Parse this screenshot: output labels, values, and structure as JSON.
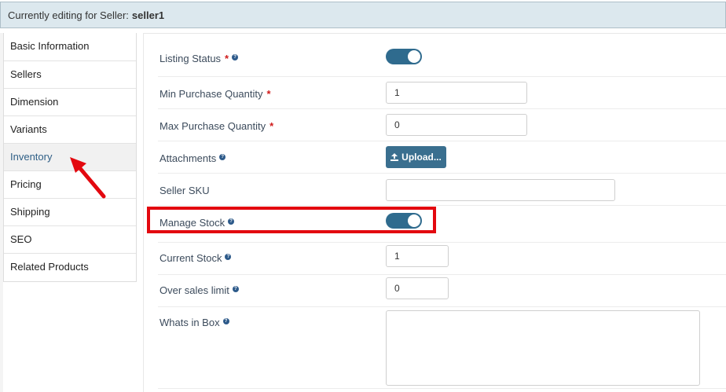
{
  "header": {
    "prefix": "Currently editing for Seller:",
    "seller": "seller1"
  },
  "sidebar": {
    "items": [
      {
        "label": "Basic Information"
      },
      {
        "label": "Sellers"
      },
      {
        "label": "Dimension"
      },
      {
        "label": "Variants"
      },
      {
        "label": "Inventory",
        "active": true
      },
      {
        "label": "Pricing"
      },
      {
        "label": "Shipping"
      },
      {
        "label": "SEO"
      },
      {
        "label": "Related Products"
      }
    ]
  },
  "form": {
    "listing_status": {
      "label": "Listing Status",
      "required": true,
      "help": true,
      "enabled": true
    },
    "min_purchase": {
      "label": "Min Purchase Quantity",
      "required": true,
      "value": "1"
    },
    "max_purchase": {
      "label": "Max Purchase Quantity",
      "required": true,
      "value": "0"
    },
    "attachments": {
      "label": "Attachments",
      "help": true,
      "button": "Upload..."
    },
    "seller_sku": {
      "label": "Seller SKU",
      "value": ""
    },
    "manage_stock": {
      "label": "Manage Stock",
      "help": true,
      "enabled": true
    },
    "current_stock": {
      "label": "Current Stock",
      "help": true,
      "value": "1"
    },
    "over_sales_limit": {
      "label": "Over sales limit",
      "help": true,
      "value": "0"
    },
    "whats_in_box": {
      "label": "Whats in Box",
      "help": true,
      "value": ""
    }
  },
  "symbols": {
    "required": "*",
    "help": "?"
  },
  "colors": {
    "accent": "#2f6b8e",
    "highlight": "#e3080f",
    "required": "#d01c1c"
  }
}
